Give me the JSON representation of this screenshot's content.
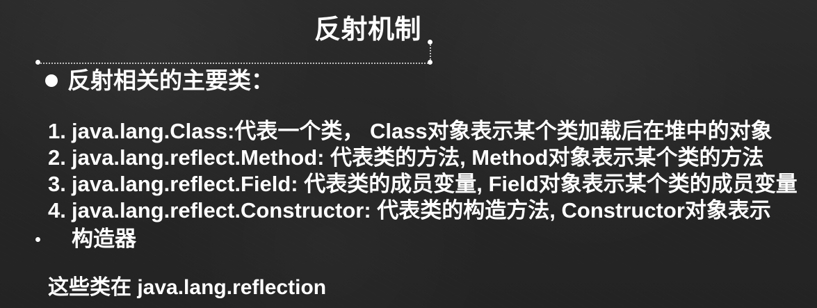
{
  "slide": {
    "title": "反射机制",
    "bullet_heading": "反射相关的主要类：",
    "items": [
      {
        "number": "1.",
        "text": "java.lang.Class:代表一个类， Class对象表示某个类加载后在堆中的对象"
      },
      {
        "number": "2.",
        "text": "java.lang.reflect.Method: 代表类的方法, Method对象表示某个类的方法"
      },
      {
        "number": "3.",
        "text": "java.lang.reflect.Field: 代表类的成员变量, Field对象表示某个类的成员变量"
      },
      {
        "number": "4.",
        "text": "java.lang.reflect.Constructor: 代表类的构造方法, Constructor对象表示"
      }
    ],
    "continuation": "构造器",
    "footer": "这些类在 java.lang.reflection"
  },
  "icons": {
    "bullet": "filled-circle-bullet"
  },
  "colors": {
    "background": "#262626",
    "text": "#ffffff",
    "guide": "#ffffff"
  }
}
